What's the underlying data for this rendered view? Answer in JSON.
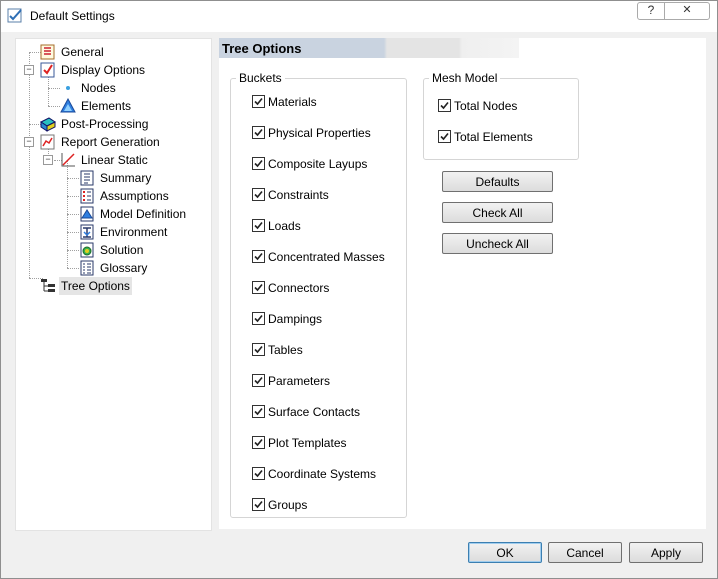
{
  "window": {
    "title": "Default Settings",
    "help_label": "?",
    "close_label": "✕"
  },
  "tree": {
    "items": [
      {
        "label": "General",
        "icon": "general-icon"
      },
      {
        "label": "Display Options",
        "icon": "display-options-icon"
      },
      {
        "label": "Nodes",
        "icon": "nodes-dot-icon"
      },
      {
        "label": "Elements",
        "icon": "elements-icon"
      },
      {
        "label": "Post-Processing",
        "icon": "post-processing-icon"
      },
      {
        "label": "Report Generation",
        "icon": "report-generation-icon"
      },
      {
        "label": "Linear Static",
        "icon": "linear-static-icon"
      },
      {
        "label": "Summary",
        "icon": "summary-icon"
      },
      {
        "label": "Assumptions",
        "icon": "assumptions-icon"
      },
      {
        "label": "Model Definition",
        "icon": "model-definition-icon"
      },
      {
        "label": "Environment",
        "icon": "environment-icon"
      },
      {
        "label": "Solution",
        "icon": "solution-icon"
      },
      {
        "label": "Glossary",
        "icon": "glossary-icon"
      },
      {
        "label": "Tree Options",
        "icon": "tree-options-icon",
        "selected": true
      }
    ]
  },
  "panel": {
    "title": "Tree Options",
    "buckets": {
      "label": "Buckets",
      "items": [
        {
          "label": "Materials",
          "checked": true
        },
        {
          "label": "Physical Properties",
          "checked": true
        },
        {
          "label": "Composite Layups",
          "checked": true
        },
        {
          "label": "Constraints",
          "checked": true
        },
        {
          "label": "Loads",
          "checked": true
        },
        {
          "label": "Concentrated Masses",
          "checked": true
        },
        {
          "label": "Connectors",
          "checked": true
        },
        {
          "label": "Dampings",
          "checked": true
        },
        {
          "label": "Tables",
          "checked": true
        },
        {
          "label": "Parameters",
          "checked": true
        },
        {
          "label": "Surface Contacts",
          "checked": true
        },
        {
          "label": "Plot Templates",
          "checked": true
        },
        {
          "label": "Coordinate Systems",
          "checked": true
        },
        {
          "label": "Groups",
          "checked": true
        }
      ]
    },
    "mesh_model": {
      "label": "Mesh Model",
      "items": [
        {
          "label": "Total Nodes",
          "checked": true
        },
        {
          "label": "Total Elements",
          "checked": true
        }
      ]
    },
    "buttons": {
      "defaults": "Defaults",
      "check_all": "Check All",
      "uncheck_all": "Uncheck All"
    }
  },
  "footer": {
    "ok": "OK",
    "cancel": "Cancel",
    "apply": "Apply"
  }
}
